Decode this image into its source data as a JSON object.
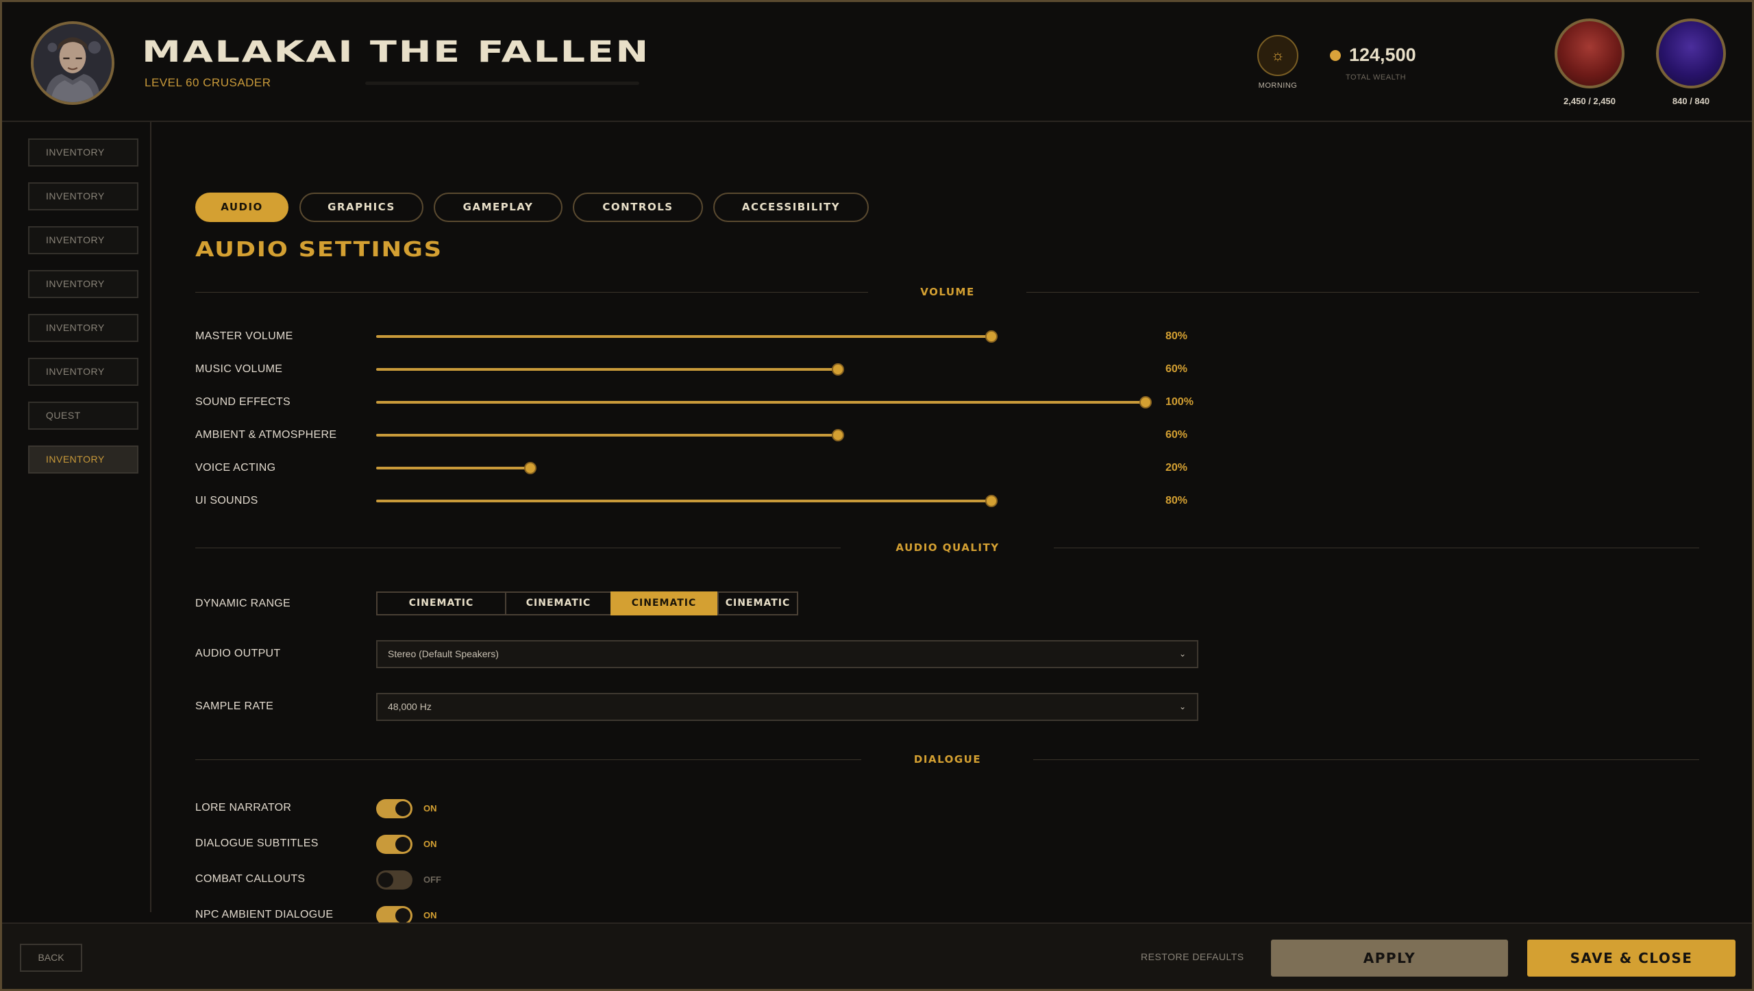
{
  "header": {
    "character_name": "MALAKAI THE FALLEN",
    "character_level": "LEVEL 60 CRUSADER",
    "time_of_day": "MORNING",
    "time_icon": "sun-icon",
    "gold_amount": "124,500",
    "gold_label": "TOTAL WEALTH",
    "health_text": "2,450 / 2,450",
    "mana_text": "840 / 840"
  },
  "sidebar": {
    "items": [
      {
        "label": "INVENTORY",
        "active": false
      },
      {
        "label": "INVENTORY",
        "active": false
      },
      {
        "label": "INVENTORY",
        "active": false
      },
      {
        "label": "INVENTORY",
        "active": false
      },
      {
        "label": "INVENTORY",
        "active": false
      },
      {
        "label": "INVENTORY",
        "active": false
      },
      {
        "label": "QUEST",
        "active": false
      },
      {
        "label": "INVENTORY",
        "active": true
      }
    ]
  },
  "tabs": [
    {
      "label": "AUDIO",
      "active": true
    },
    {
      "label": "GRAPHICS",
      "active": false
    },
    {
      "label": "GAMEPLAY",
      "active": false
    },
    {
      "label": "CONTROLS",
      "active": false
    },
    {
      "label": "ACCESSIBILITY",
      "active": false
    }
  ],
  "section_title": "AUDIO SETTINGS",
  "volume": {
    "heading": "VOLUME",
    "sliders": [
      {
        "label": "MASTER VOLUME",
        "value": 80,
        "value_text": "80%"
      },
      {
        "label": "MUSIC VOLUME",
        "value": 60,
        "value_text": "60%"
      },
      {
        "label": "SOUND EFFECTS",
        "value": 100,
        "value_text": "100%"
      },
      {
        "label": "AMBIENT & ATMOSPHERE",
        "value": 60,
        "value_text": "60%"
      },
      {
        "label": "VOICE ACTING",
        "value": 20,
        "value_text": "20%"
      },
      {
        "label": "UI SOUNDS",
        "value": 80,
        "value_text": "80%"
      }
    ]
  },
  "audio_quality": {
    "heading": "AUDIO QUALITY",
    "dynamic_range": {
      "label": "DYNAMIC RANGE",
      "options": [
        "CINEMATIC",
        "CINEMATIC",
        "CINEMATIC",
        "CINEMATIC"
      ],
      "selected_index": 2
    },
    "audio_output": {
      "label": "AUDIO OUTPUT",
      "value": "Stereo (Default Speakers)"
    },
    "sample_rate": {
      "label": "SAMPLE RATE",
      "value": "48,000 Hz"
    }
  },
  "dialogue": {
    "heading": "DIALOGUE",
    "toggles": [
      {
        "label": "LORE NARRATOR",
        "on": true,
        "state_text": "ON"
      },
      {
        "label": "DIALOGUE SUBTITLES",
        "on": true,
        "state_text": "ON"
      },
      {
        "label": "COMBAT CALLOUTS",
        "on": false,
        "state_text": "OFF"
      },
      {
        "label": "NPC AMBIENT DIALOGUE",
        "on": true,
        "state_text": "ON"
      }
    ]
  },
  "footer": {
    "back_label": "BACK",
    "restore_label": "RESTORE DEFAULTS",
    "apply_label": "APPLY",
    "save_label": "SAVE & CLOSE"
  },
  "colors": {
    "accent": "#d4a032",
    "background": "#0e0d0c",
    "health": "#8a2a25",
    "mana": "#34198a"
  }
}
